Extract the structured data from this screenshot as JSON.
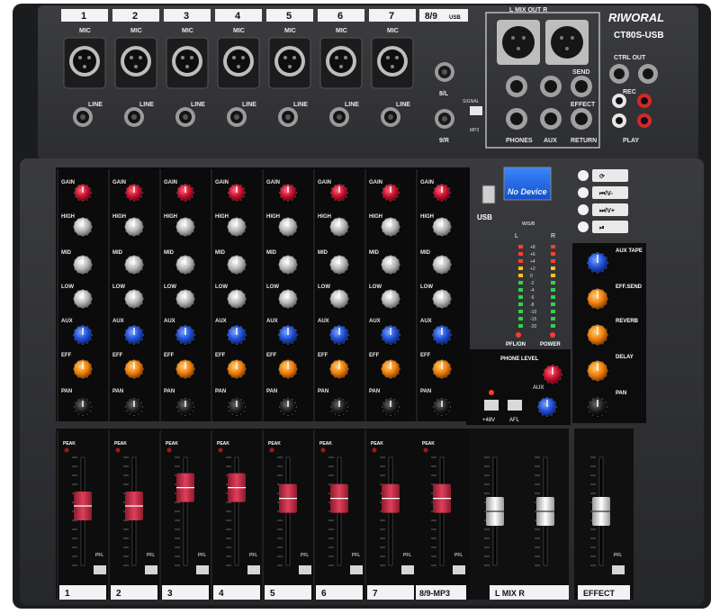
{
  "brand": {
    "name": "RIWORAL",
    "model": "CT80S-USB"
  },
  "colors": {
    "body": "#2b2c2e",
    "panel": "#0c0c0c",
    "gain": "#c8102e",
    "aux": "#1f4fd6",
    "eff": "#f07f0a",
    "fader_red": "#d2314d"
  },
  "top": {
    "channel_numbers": [
      "1",
      "2",
      "3",
      "4",
      "5",
      "6",
      "7"
    ],
    "stereo_number": "8/9",
    "stereo_usb": "USB",
    "mic_label": "MIC",
    "line_label": "LINE",
    "stereo_left": "8/L",
    "stereo_right": "9/R",
    "signal_label": "SIGNAL",
    "mp3_label": "MP3",
    "mix_out": "L    MIX OUT    R",
    "phones": "PHONES",
    "aux": "AUX",
    "return": "RETURN",
    "send": "SEND",
    "effect": "EFFECT",
    "ctrl_out": "CTRL OUT",
    "rec": "REC",
    "play": "PLAY"
  },
  "strip_labels": {
    "gain": "GAIN",
    "high": "HIGH",
    "mid": "MID",
    "low": "LOW",
    "aux": "AUX",
    "eff": "EFF",
    "pan": "PAN",
    "peak": "PEAK",
    "pfl": "PFL"
  },
  "usb": {
    "display_text": "No Device",
    "usb_label": "USB",
    "wsb_label": "W/S/B",
    "buttons": [
      "⟳",
      "⏮/V-",
      "⏭/V+",
      "⏯"
    ]
  },
  "meter": {
    "left": "L",
    "right": "R",
    "scale": [
      "+8",
      "+6",
      "+4",
      "+2",
      "0",
      "-2",
      "-4",
      "-6",
      "-8",
      "-10",
      "-15",
      "-20"
    ],
    "pfl_on": "PFL/ON",
    "power": "POWER"
  },
  "master": {
    "phone_level": "PHONE LEVEL",
    "aux": "AUX",
    "phantom": "+48V",
    "afl": "AFL",
    "aux_tape": "AUX TAPE",
    "eff_send": "EFF.SEND",
    "reverb": "REVERB",
    "delay": "DELAY",
    "pan": "PAN"
  },
  "bottom": {
    "channels": [
      "1",
      "2",
      "3",
      "4",
      "5",
      "6",
      "7"
    ],
    "mp3": "8/9-MP3",
    "mix": "L    MIX    R",
    "effect": "EFFECT"
  },
  "fader_levels": [
    0.55,
    0.55,
    0.72,
    0.72,
    0.62,
    0.62,
    0.62,
    0.62,
    0.5,
    0.5,
    0.5
  ]
}
